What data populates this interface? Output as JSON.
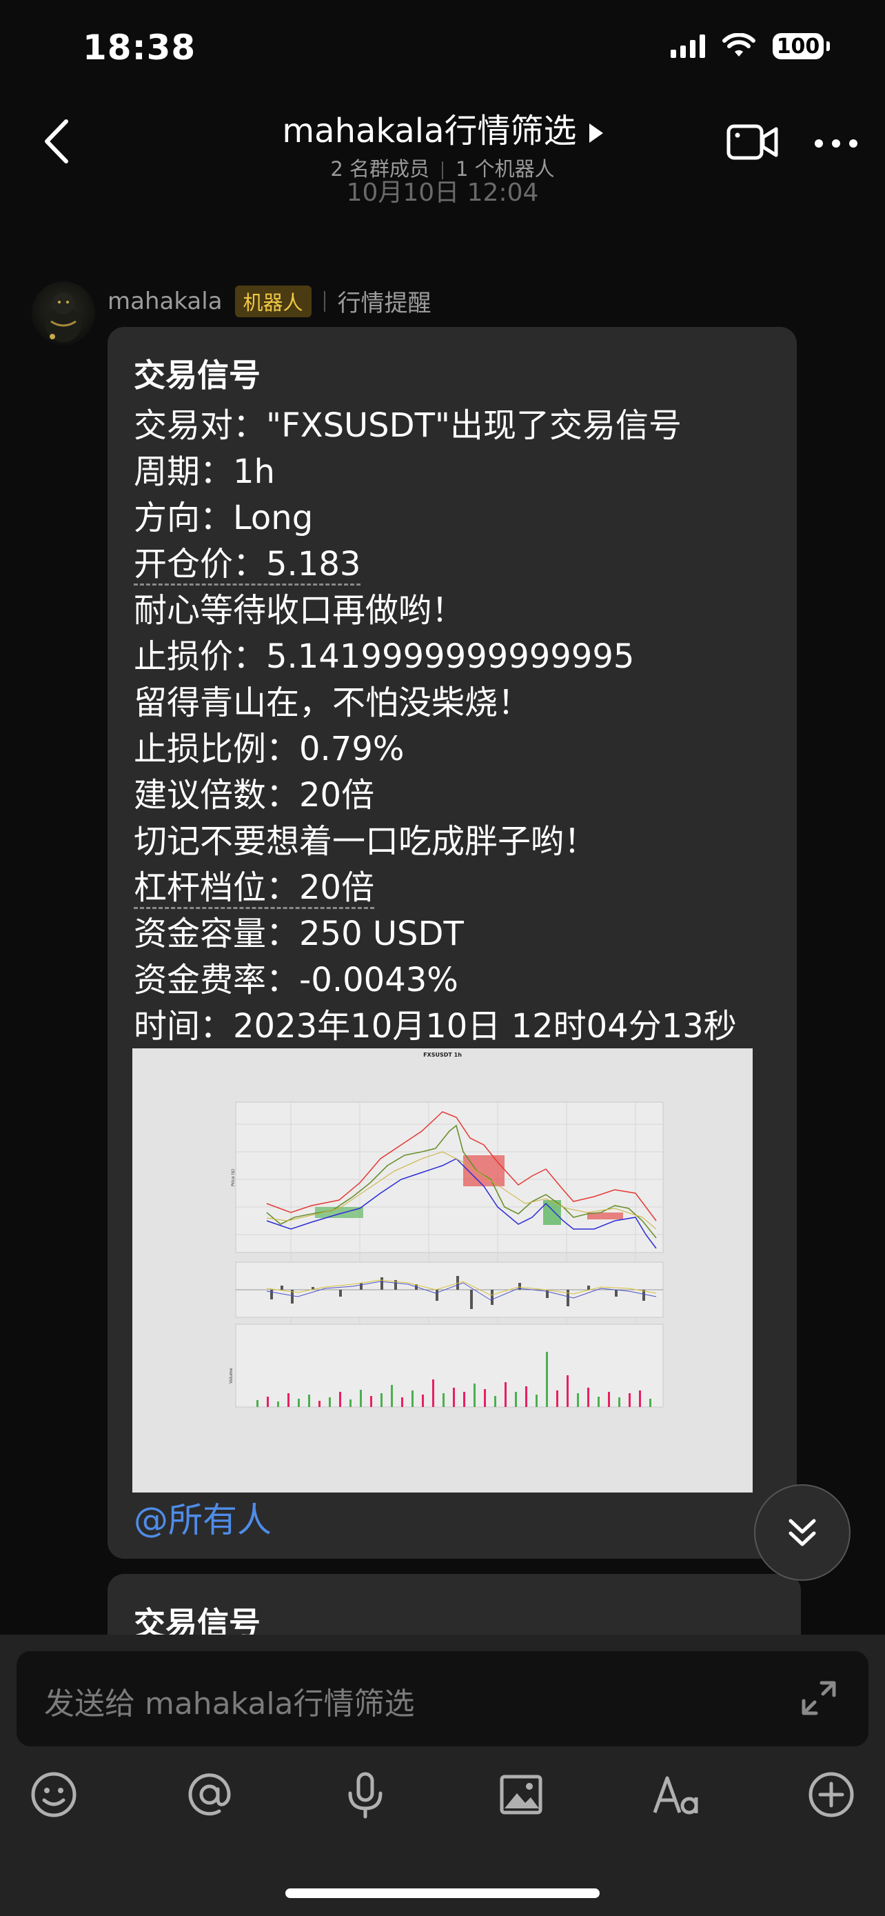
{
  "status_bar": {
    "time": "18:38",
    "battery": "100"
  },
  "header": {
    "title": "mahakala行情筛选",
    "member_count": "2 名群成员",
    "bot_count": "1 个机器人"
  },
  "date_separator": "10月10日 12:04",
  "message": {
    "sender": "mahakala",
    "badge": "机器人",
    "tag": "行情提醒",
    "title": "交易信号",
    "lines": [
      "交易对：\"FXSUSDT\"出现了交易信号",
      "周期：1h",
      "方向：Long",
      "开仓价：5.183",
      "耐心等待收口再做哟！",
      "止损价：5.1419999999999995",
      "留得青山在，不怕没柴烧！",
      "止损比例：0.79%",
      "建议倍数：20倍",
      "切记不要想着一口吃成胖子哟！",
      "杠杆档位：20倍",
      "资金容量：250 USDT",
      "资金费率：-0.0043%",
      "时间：2023年10月10日 12时04分13秒"
    ],
    "chart_title": "FXSUSDT 1h",
    "chart_ylabel": "Price ($)",
    "chart_vol_label": "Volume",
    "mention": "@所有人"
  },
  "message2": {
    "title": "交易信号"
  },
  "input": {
    "placeholder": "发送给 mahakala行情筛选"
  },
  "toolbar": [
    "emoji-icon",
    "at-icon",
    "microphone-icon",
    "image-icon",
    "text-format-icon",
    "add-icon"
  ]
}
